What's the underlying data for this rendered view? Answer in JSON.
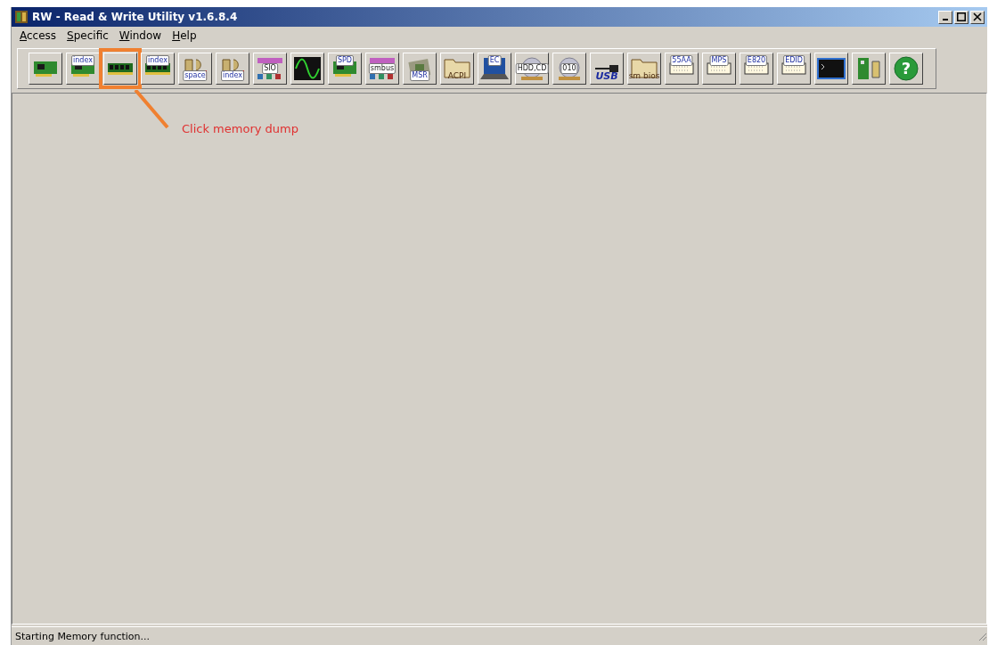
{
  "window": {
    "title": "RW - Read & Write Utility v1.6.8.4"
  },
  "menu": [
    {
      "label": "Access"
    },
    {
      "label": "Specific"
    },
    {
      "label": "Window"
    },
    {
      "label": "Help"
    }
  ],
  "toolbar": [
    {
      "kind": "card",
      "highlighted": false
    },
    {
      "kind": "card",
      "label": "index",
      "highlighted": false
    },
    {
      "kind": "memory",
      "highlighted": true
    },
    {
      "kind": "memory",
      "label": "index",
      "highlighted": false
    },
    {
      "kind": "io",
      "label": "space",
      "highlighted": false
    },
    {
      "kind": "io",
      "label": "index",
      "highlighted": false
    },
    {
      "kind": "chip",
      "label": "SIO",
      "highlighted": false
    },
    {
      "kind": "wave",
      "highlighted": false
    },
    {
      "kind": "card",
      "label": "SPD",
      "highlighted": false
    },
    {
      "kind": "chip",
      "label": "smbus",
      "highlighted": false
    },
    {
      "kind": "cpu",
      "label": "MSR",
      "highlighted": false
    },
    {
      "kind": "folder",
      "label": "ACPI",
      "highlighted": false
    },
    {
      "kind": "laptop",
      "label": "EC",
      "highlighted": false
    },
    {
      "kind": "disk",
      "label": "HDD,CD",
      "highlighted": false
    },
    {
      "kind": "disk",
      "label": "010",
      "highlighted": false
    },
    {
      "kind": "usb",
      "label": "USB",
      "highlighted": false
    },
    {
      "kind": "folder",
      "label": "sm bios",
      "highlighted": false
    },
    {
      "kind": "table",
      "label": "55AA",
      "highlighted": false
    },
    {
      "kind": "table",
      "label": "MPS",
      "highlighted": false
    },
    {
      "kind": "table",
      "label": "E820",
      "highlighted": false
    },
    {
      "kind": "table",
      "label": "EDID",
      "highlighted": false
    },
    {
      "kind": "terminal",
      "highlighted": false
    },
    {
      "kind": "pci",
      "highlighted": false
    },
    {
      "kind": "help",
      "label": "?",
      "highlighted": false
    }
  ],
  "annotation": {
    "text": "Click memory dump"
  },
  "status_bar": {
    "text": "Starting Memory function..."
  }
}
